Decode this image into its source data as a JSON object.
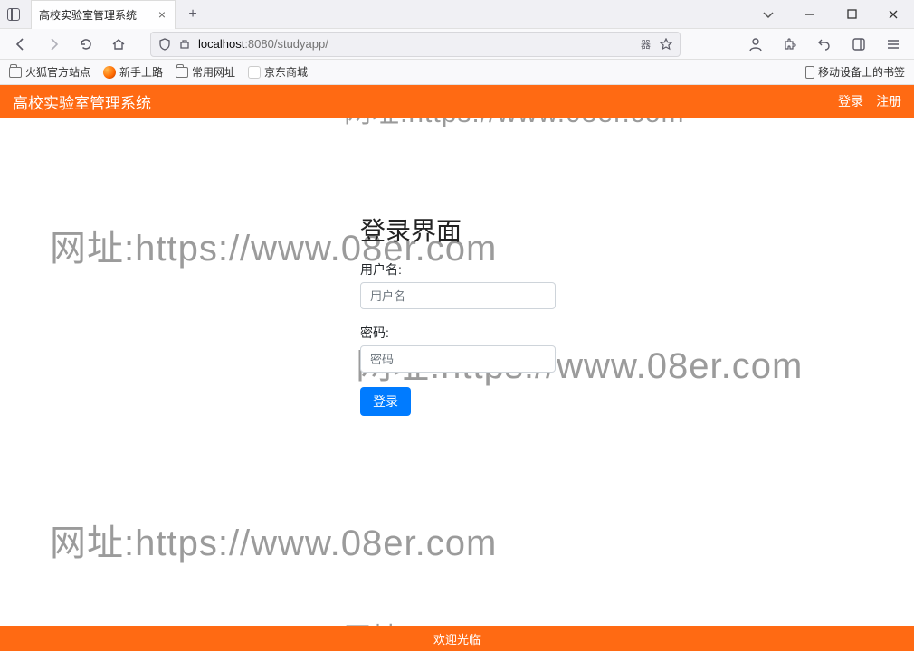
{
  "browser": {
    "tab_title": "高校实验室管理系统",
    "url_host": "localhost",
    "url_port_path": ":8080/studyapp/",
    "reader_badge": "器"
  },
  "bookmarks": {
    "items": [
      "火狐官方站点",
      "新手上路",
      "常用网址",
      "京东商城"
    ],
    "mobile": "移动设备上的书签"
  },
  "site": {
    "title": "高校实验室管理系统",
    "nav_login": "登录",
    "nav_register": "注册",
    "footer": "欢迎光临"
  },
  "login": {
    "heading": "登录界面",
    "username_label": "用户名:",
    "username_placeholder": "用户名",
    "password_label": "密码:",
    "password_placeholder": "密码",
    "submit": "登录"
  },
  "watermark": "网址:https://www.08er.com",
  "colors": {
    "brand_orange": "#ff6a13",
    "primary_blue": "#007bff"
  }
}
